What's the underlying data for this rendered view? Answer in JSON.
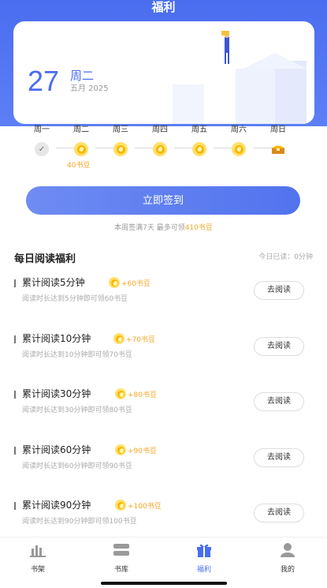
{
  "header": {
    "title": "福利"
  },
  "checkin": {
    "date": "27",
    "weekday": "周二",
    "month": "五月 2025",
    "days": [
      "周一",
      "周二",
      "周三",
      "周四",
      "周五",
      "周六",
      "周日"
    ],
    "today_reward": "40书豆",
    "button_label": "立即签到",
    "note_prefix": "本周签满7天 最多可领",
    "note_highlight": "410书豆"
  },
  "daily": {
    "title": "每日阅读福利",
    "today_read": "今日已读：0分钟",
    "tasks": [
      {
        "name": "累计阅读5分钟",
        "reward": "+60书豆",
        "desc": "阅读时长达到5分钟即可领60书豆",
        "button": "去阅读"
      },
      {
        "name": "累计阅读10分钟",
        "reward": "+70书豆",
        "desc": "阅读时长达到10分钟即可领70书豆",
        "button": "去阅读"
      },
      {
        "name": "累计阅读30分钟",
        "reward": "+80书豆",
        "desc": "阅读时长达到30分钟即可领80书豆",
        "button": "去阅读"
      },
      {
        "name": "累计阅读60分钟",
        "reward": "+90书豆",
        "desc": "阅读时长达到60分钟即可领90书豆",
        "button": "去阅读"
      },
      {
        "name": "累计阅读90分钟",
        "reward": "+100书豆",
        "desc": "阅读时长达到90分钟即可领100书豆",
        "button": "去阅读"
      }
    ]
  },
  "tabbar": {
    "items": [
      {
        "label": "书架",
        "icon": "bookshelf-icon"
      },
      {
        "label": "书库",
        "icon": "library-icon"
      },
      {
        "label": "福利",
        "icon": "gift-icon",
        "active": true
      },
      {
        "label": "我的",
        "icon": "profile-icon"
      }
    ]
  },
  "colors": {
    "primary": "#4a6df0",
    "coin": "#f5a623"
  }
}
